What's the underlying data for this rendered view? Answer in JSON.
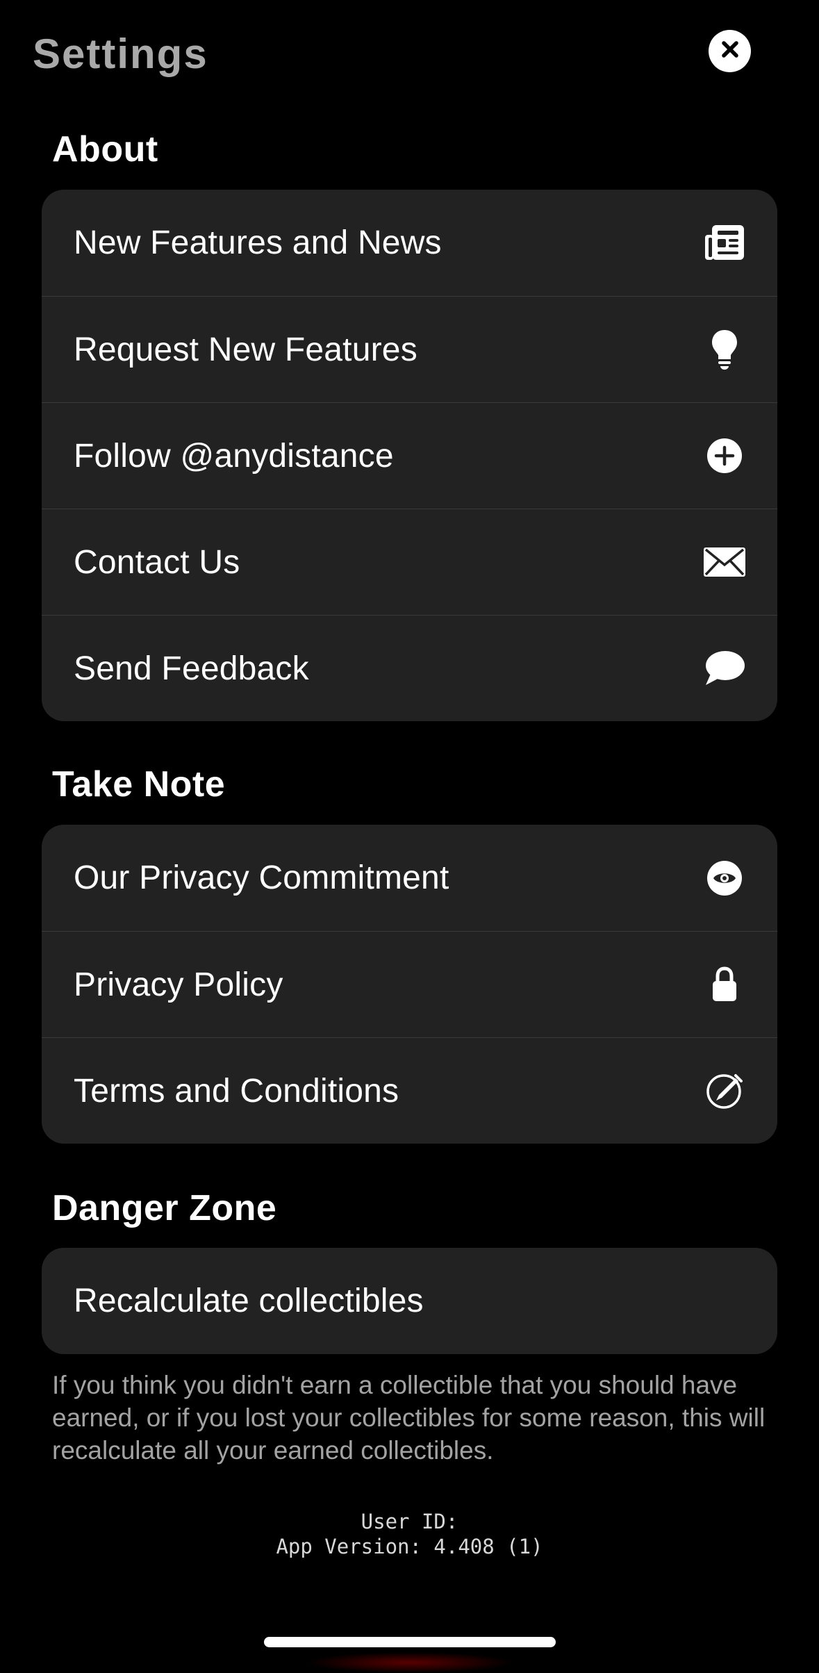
{
  "header": {
    "title": "Settings",
    "close_icon": "close-icon"
  },
  "sections": {
    "about": {
      "title": "About",
      "items": [
        {
          "label": "New Features and News",
          "icon": "newspaper-icon"
        },
        {
          "label": "Request New Features",
          "icon": "lightbulb-icon"
        },
        {
          "label": "Follow @anydistance",
          "icon": "plus-circle-icon"
        },
        {
          "label": "Contact Us",
          "icon": "envelope-icon"
        },
        {
          "label": "Send Feedback",
          "icon": "speech-bubble-icon"
        }
      ]
    },
    "take_note": {
      "title": "Take Note",
      "items": [
        {
          "label": "Our Privacy Commitment",
          "icon": "eye-icon"
        },
        {
          "label": "Privacy Policy",
          "icon": "lock-icon"
        },
        {
          "label": "Terms and Conditions",
          "icon": "signature-icon"
        }
      ]
    },
    "danger_zone": {
      "title": "Danger Zone",
      "items": [
        {
          "label": "Recalculate collectibles"
        }
      ],
      "description": "If you think you didn't earn a collectible that you should have earned, or if you lost your collectibles for some reason, this will recalculate all your earned collectibles."
    }
  },
  "footer": {
    "user_id": "User ID:",
    "app_version": "App Version: 4.408 (1)"
  },
  "colors": {
    "background": "#000000",
    "card": "#222222",
    "title_gray": "#a9a9a9",
    "text": "#ffffff",
    "muted_text": "#a3a3a3"
  }
}
